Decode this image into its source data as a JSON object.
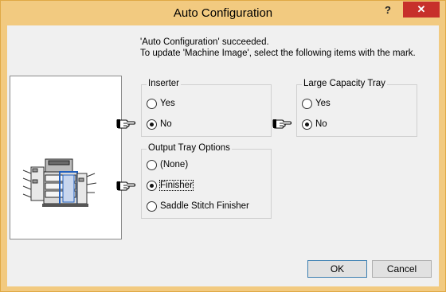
{
  "window": {
    "title": "Auto Configuration",
    "help_label": "?",
    "close_label": "✕"
  },
  "message": {
    "line1": "'Auto Configuration' succeeded.",
    "line2": "To update 'Machine Image', select the following items with the mark."
  },
  "groups": {
    "inserter": {
      "label": "Inserter",
      "options": [
        "Yes",
        "No"
      ],
      "selected": "No",
      "marked": "No"
    },
    "large_capacity_tray": {
      "label": "Large Capacity Tray",
      "options": [
        "Yes",
        "No"
      ],
      "selected": "No",
      "marked": "No"
    },
    "output_tray_options": {
      "label": "Output Tray Options",
      "options": [
        "(None)",
        "Finisher",
        "Saddle Stitch Finisher"
      ],
      "selected": "Finisher",
      "marked": "Finisher"
    }
  },
  "buttons": {
    "ok": "OK",
    "cancel": "Cancel"
  },
  "icons": {
    "pointer": "pointing-hand-icon",
    "machine": "copier-machine-image"
  }
}
